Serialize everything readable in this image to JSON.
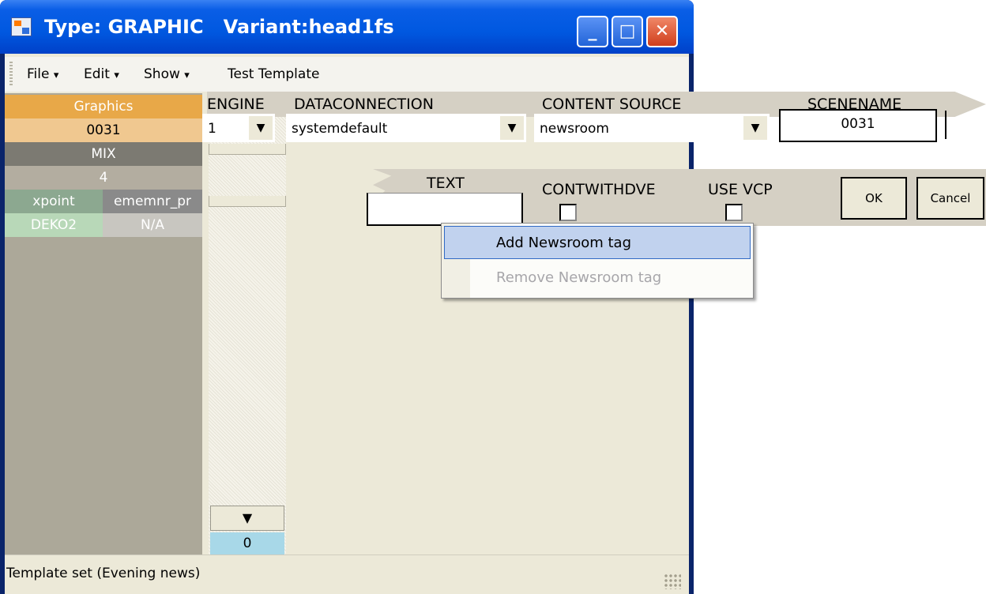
{
  "window": {
    "title": "Type: GRAPHIC   Variant:head1fs",
    "minimize_glyph": "_",
    "maximize_glyph": "□",
    "close_glyph": "✕"
  },
  "menubar": {
    "items": [
      {
        "label": "File",
        "arrow": "▾"
      },
      {
        "label": "Edit",
        "arrow": "▾"
      },
      {
        "label": "Show",
        "arrow": "▾"
      },
      {
        "label": "Test Template",
        "arrow": ""
      }
    ]
  },
  "left_panel": {
    "graphics": "Graphics",
    "number": "0031",
    "mix": "MIX",
    "value": "4",
    "xpoint": "xpoint",
    "ememnr": "ememnr_pr",
    "deko": "DEKO2",
    "na": "N/A"
  },
  "scroller": {
    "down_glyph": "▼",
    "count": "0"
  },
  "header_fields": {
    "engine_label": "ENGINE",
    "engine_value": "1",
    "dataconnection_label": "DATACONNECTION",
    "dataconnection_value": "systemdefault",
    "content_source_label": "CONTENT SOURCE",
    "content_source_value": "newsroom",
    "scenename_label": "SCENENAME",
    "scenename_value": "0031",
    "dropdown_glyph": "▼"
  },
  "fields_row": {
    "text_label": "TEXT",
    "text_value": "",
    "contwithdve_label": "CONTWITHDVE",
    "use_vcp_label": "USE VCP",
    "ok_label": "OK",
    "cancel_label": "Cancel"
  },
  "context_menu": {
    "items": [
      {
        "label": "Add Newsroom tag",
        "enabled": true,
        "highlighted": true
      },
      {
        "label": "Remove Newsroom tag",
        "enabled": false,
        "highlighted": false
      }
    ]
  },
  "statusbar": {
    "text": "Template set (Evening news)"
  },
  "colors": {
    "title_blue": "#0058e0",
    "graphics_orange": "#e8a848",
    "highlight": "#c1d2ee"
  }
}
